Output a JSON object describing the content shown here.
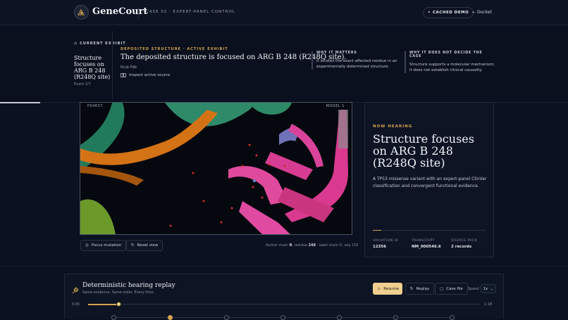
{
  "header": {
    "brand": "GeneCourt",
    "case_label": "CASE 02 · EXPERT-PANEL CONTROL",
    "cached_label": "CACHED DEMO",
    "docket_label": "Docket"
  },
  "exhibit": {
    "current_label": "CURRENT EXHIBIT",
    "current_title": "Structure focuses on ARG B 248 (R248Q site)",
    "event": "Event 2/7",
    "deposited_label": "DEPOSITED STRUCTURE · ACTIVE EXHIBIT",
    "deposited_text": "The deposited structure is focused on ARG B 248 (R248Q site).",
    "source": "Rcsb Pdb",
    "inspect_label": "Inspect active source",
    "why_matters_title": "WHY IT MATTERS",
    "why_matters_text": "It locates the exact affected residue in an experimentally determined structure.",
    "why_not_title": "WHY IT DOES NOT DECIDE THE CASE",
    "why_not_text": "Structure supports a molecular mechanism; it does not establish clinical causality."
  },
  "viewer": {
    "id_tag": "P04637",
    "model_tag": "MODEL 1",
    "focus_label": "Focus mutation",
    "reset_label": "Reset view",
    "author_pre": "Author chain ",
    "author_chain": "B",
    "author_mid": ", residue ",
    "author_res": "248",
    "author_post": " · label chain D, seq 155"
  },
  "hearing": {
    "now_label": "NOW HEARING",
    "title": "Structure focuses on ARG B 248 (R248Q site)",
    "description": "A TP53 missense variant with an expert-panel ClinVar classification and convergent functional evidence.",
    "stats": [
      {
        "key": "VARIATION ID",
        "value": "12356"
      },
      {
        "key": "TRANSCRIPT",
        "value": "NM_000546.6"
      },
      {
        "key": "SOURCE PACK",
        "value": "2 records"
      }
    ]
  },
  "replay": {
    "title": "Deterministic hearing replay",
    "subtitle": "Same evidence. Same order. Every time.",
    "resume_label": "Resume",
    "replay_label": "Replay",
    "casefile_label": "Case file",
    "speed_label": "Speed",
    "speed_value": "1x",
    "time_start": "0:05",
    "time_end": "1:18",
    "progress": 0.08
  },
  "colors": {
    "accent": "#d6a44d",
    "resume_bg": "#efcf8f"
  }
}
